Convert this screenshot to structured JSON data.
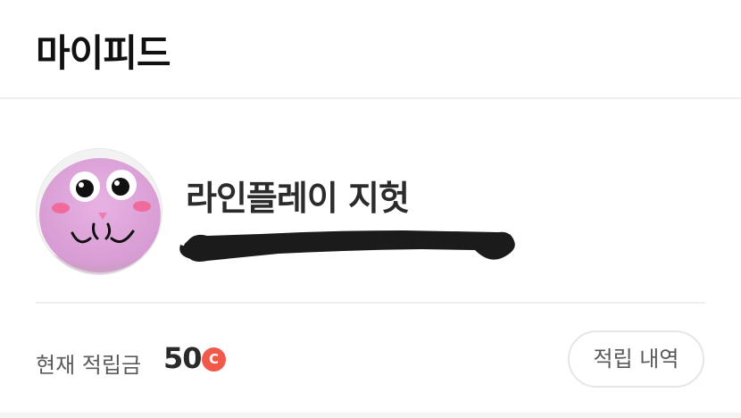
{
  "header": {
    "title": "마이피드"
  },
  "profile": {
    "avatar_icon": "pink-cat-avatar-icon",
    "nickname": "라인플레이 지헛"
  },
  "points": {
    "label": "현재 적립금",
    "value": "50",
    "currency_symbol": "C",
    "currency_color": "#f15a4a",
    "history_button_label": "적립 내역"
  }
}
